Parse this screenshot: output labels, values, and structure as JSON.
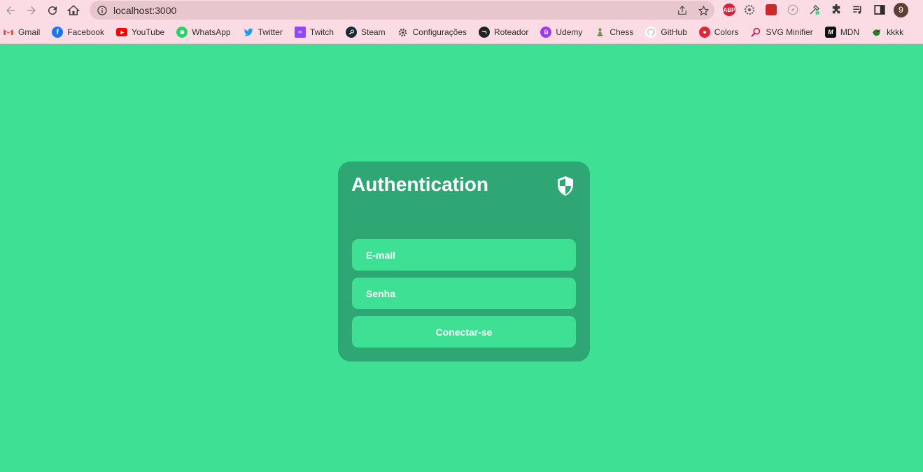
{
  "browser": {
    "url": "localhost:3000",
    "profile_initial": "9",
    "extensions": [
      "adblock-plus",
      "gear-extension",
      "red-extension",
      "compass-extension",
      "color-picker-extension",
      "puzzle-extensions",
      "media-control"
    ]
  },
  "bookmarks": [
    {
      "label": "Gmail",
      "icon": "gmail-icon"
    },
    {
      "label": "Facebook",
      "icon": "facebook-icon"
    },
    {
      "label": "YouTube",
      "icon": "youtube-icon"
    },
    {
      "label": "WhatsApp",
      "icon": "whatsapp-icon"
    },
    {
      "label": "Twitter",
      "icon": "twitter-icon"
    },
    {
      "label": "Twitch",
      "icon": "twitch-icon"
    },
    {
      "label": "Steam",
      "icon": "steam-icon"
    },
    {
      "label": "Configurações",
      "icon": "gear-icon"
    },
    {
      "label": "Roteador",
      "icon": "globe-icon"
    },
    {
      "label": "Udemy",
      "icon": "udemy-icon"
    },
    {
      "label": "Chess",
      "icon": "chess-pawn-icon"
    },
    {
      "label": "GitHub",
      "icon": "github-icon"
    },
    {
      "label": "Colors",
      "icon": "colors-icon"
    },
    {
      "label": "SVG Minifier",
      "icon": "magnifier-icon"
    },
    {
      "label": "MDN",
      "icon": "mdn-icon"
    },
    {
      "label": "kkkk",
      "icon": "dragon-icon"
    }
  ],
  "auth": {
    "title": "Authentication",
    "email_placeholder": "E-mail",
    "password_placeholder": "Senha",
    "submit_label": "Conectar-se"
  },
  "colors": {
    "background": "#3ee094",
    "card": "#2fa775",
    "input": "#3ee094",
    "text": "#ffffff"
  }
}
